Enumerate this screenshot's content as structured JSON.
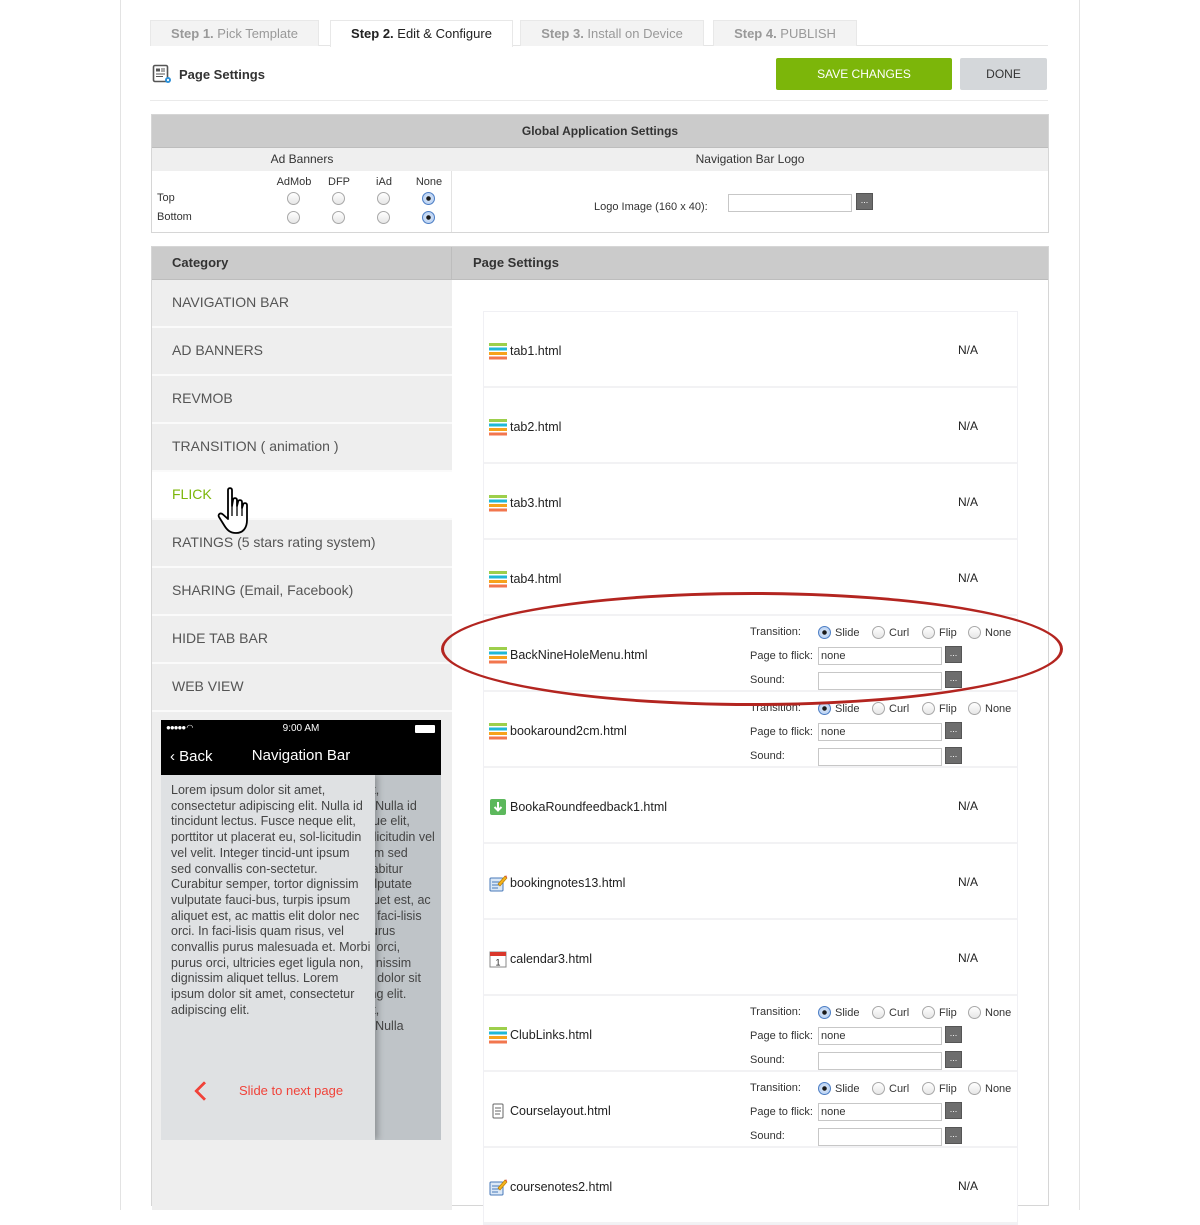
{
  "steps": [
    {
      "num": "Step 1.",
      "label": " Pick Template",
      "active": false
    },
    {
      "num": "Step 2.",
      "label": " Edit & Configure",
      "active": true
    },
    {
      "num": "Step 3.",
      "label": " Install on Device",
      "active": false
    },
    {
      "num": "Step 4.",
      "label": " PUBLISH",
      "active": false
    }
  ],
  "header": {
    "title": "Page Settings",
    "icon": "page-settings-icon",
    "save_label": "SAVE CHANGES",
    "done_label": "DONE"
  },
  "colors": {
    "accent_green": "#7cb60a",
    "annotation_red": "#b32520",
    "slide_red": "#f0433a"
  },
  "global": {
    "title": "Global Application Settings",
    "ad_banners_label": "Ad Banners",
    "nav_logo_label": "Navigation Bar Logo",
    "ad_columns": [
      "AdMob",
      "DFP",
      "iAd",
      "None"
    ],
    "ad_rows": [
      {
        "label": "Top",
        "selected": "None"
      },
      {
        "label": "Bottom",
        "selected": "None"
      }
    ],
    "logo_label": "Logo Image (160 x 40):",
    "logo_value": "",
    "browse_label": "..."
  },
  "category": {
    "header": "Category",
    "items": [
      {
        "label": "NAVIGATION BAR",
        "active": false
      },
      {
        "label": "AD BANNERS",
        "active": false
      },
      {
        "label": "REVMOB",
        "active": false
      },
      {
        "label": "TRANSITION ( animation )",
        "active": false
      },
      {
        "label": "FLICK",
        "active": true
      },
      {
        "label": "RATINGS (5 stars rating system)",
        "active": false
      },
      {
        "label": "SHARING (Email, Facebook)",
        "active": false
      },
      {
        "label": "HIDE TAB BAR",
        "active": false
      },
      {
        "label": "WEB VIEW",
        "active": false
      }
    ]
  },
  "preview": {
    "time": "9:00 AM",
    "back_label": "Back",
    "nav_title": "Navigation Bar",
    "body_text": "Lorem ipsum dolor sit amet, consectetur adipiscing elit. Nulla id tincidunt lectus. Fusce neque elit, porttitor ut placerat eu, sol-licitudin vel velit. Integer tincid-unt ipsum sed convallis con-sectetur. Curabitur semper, tortor dignissim vulputate fauci-bus, turpis ipsum aliquet est, ac mattis elit dolor nec orci. In faci-lisis quam risus, vel convallis purus malesuada et. Morbi purus orci, ultricies eget ligula non, dignissim aliquet tellus. Lorem ipsum dolor sit amet, consectetur adipiscing elit.",
    "back_page_text": "Lorem ipsum dolor sit amet, consectetur adipiscing elit. Nulla id tincidunt lectus. Fusce neque elit, porttitor ut placerat eu, sol-licitudin vel velit. Integer tincid-unt ipsum sed convallis con-sectetur. Curabitur semper, tortor dignissim vulputate fauci-bus, turpis ipsum aliquet est, ac mattis elit dolor nec orci. In faci-lisis quam risus, vel convallis purus malesuada et. Morbi purus orci, ultricies eget ligula non, dignissim aliquet tellus. Lorem ipsum dolor sit amet, consectetur adipiscing elit. Lorem ipsum dolor sit amet, consectetur adipiscing elit. Nulla",
    "slide_label": "Slide to next page"
  },
  "page_settings": {
    "header": "Page Settings",
    "labels": {
      "transition": "Transition:",
      "page_to_flick": "Page to flick:",
      "sound": "Sound:",
      "na": "N/A",
      "browse": "..."
    },
    "transition_options": [
      "Slide",
      "Curl",
      "Flip",
      "None"
    ],
    "pages": [
      {
        "name": "tab1.html",
        "icon": "tab-bars-icon",
        "configurable": false
      },
      {
        "name": "tab2.html",
        "icon": "tab-bars-icon",
        "configurable": false
      },
      {
        "name": "tab3.html",
        "icon": "tab-bars-icon",
        "configurable": false
      },
      {
        "name": "tab4.html",
        "icon": "tab-bars-icon",
        "configurable": false
      },
      {
        "name": "BackNineHoleMenu.html",
        "icon": "tab-bars-icon",
        "configurable": true,
        "transition": "Slide",
        "page_to_flick": "none",
        "sound": ""
      },
      {
        "name": "bookaround2cm.html",
        "icon": "tab-bars-icon",
        "configurable": true,
        "transition": "Slide",
        "page_to_flick": "none",
        "sound": ""
      },
      {
        "name": "BookaRoundfeedback1.html",
        "icon": "download-icon",
        "configurable": false
      },
      {
        "name": "bookingnotes13.html",
        "icon": "notes-pencil-icon",
        "configurable": false
      },
      {
        "name": "calendar3.html",
        "icon": "calendar-icon",
        "configurable": false
      },
      {
        "name": "ClubLinks.html",
        "icon": "tab-bars-icon",
        "configurable": true,
        "transition": "Slide",
        "page_to_flick": "none",
        "sound": ""
      },
      {
        "name": "Courselayout.html",
        "icon": "document-icon",
        "configurable": true,
        "transition": "Slide",
        "page_to_flick": "none",
        "sound": ""
      },
      {
        "name": "coursenotes2.html",
        "icon": "notes-pencil-icon",
        "configurable": false
      }
    ]
  }
}
